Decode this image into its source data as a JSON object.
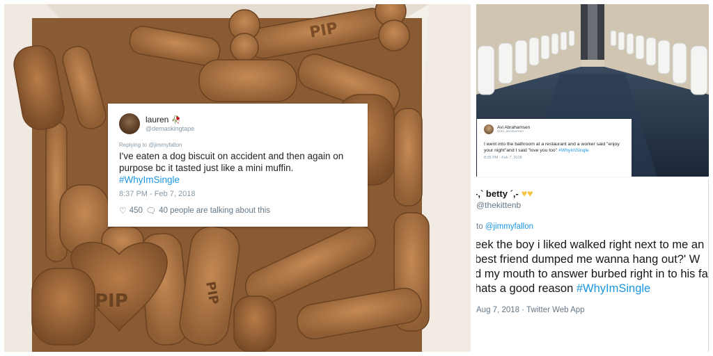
{
  "left_image": {
    "stamp_text": "PIP",
    "tweet": {
      "name": "lauren",
      "handle": "@demaskingtape",
      "replying_to": "Replying to @jimmyfallon",
      "text": "I've eaten a dog biscuit on accident and then again on purpose bc it tasted just like a mini muffin.",
      "hashtag": "#WhyImSingle",
      "timestamp": "8:37 PM - Feb 7, 2018",
      "likes": "450",
      "talking": "40 people are talking about this"
    }
  },
  "top_right_image": {
    "tweet": {
      "name": "Avi Abrahamsen",
      "handle": "@avi_abrahamsen",
      "text": "I went into the bathroom at a restaurant and a worker said \"enjoy your night\"and I said \"love you too\"",
      "hashtag": "#WhyImSingle",
      "timestamp": "8:35 PM - Feb 7, 2018"
    }
  },
  "bottom_right_image": {
    "tweet": {
      "name": "-,` betty ´,-",
      "handle": "@thekittenb",
      "reply_prefix": "to",
      "reply_handle": "@jimmyfallon",
      "lines": [
        "eek the boy i liked walked right next to me an",
        " best friend dumped me wanna hang out?' W",
        "d my mouth to answer burbed right in to his fa",
        "hats a good reason "
      ],
      "hashtag": "#WhyImSingle",
      "timestamp": "Aug 7, 2018 · Twitter Web App"
    }
  },
  "colors": {
    "hashtag": "#1b95e0",
    "secondary_text": "#657786",
    "biscuit": "#b07a4a",
    "heart_yellow": "#f5c242"
  }
}
